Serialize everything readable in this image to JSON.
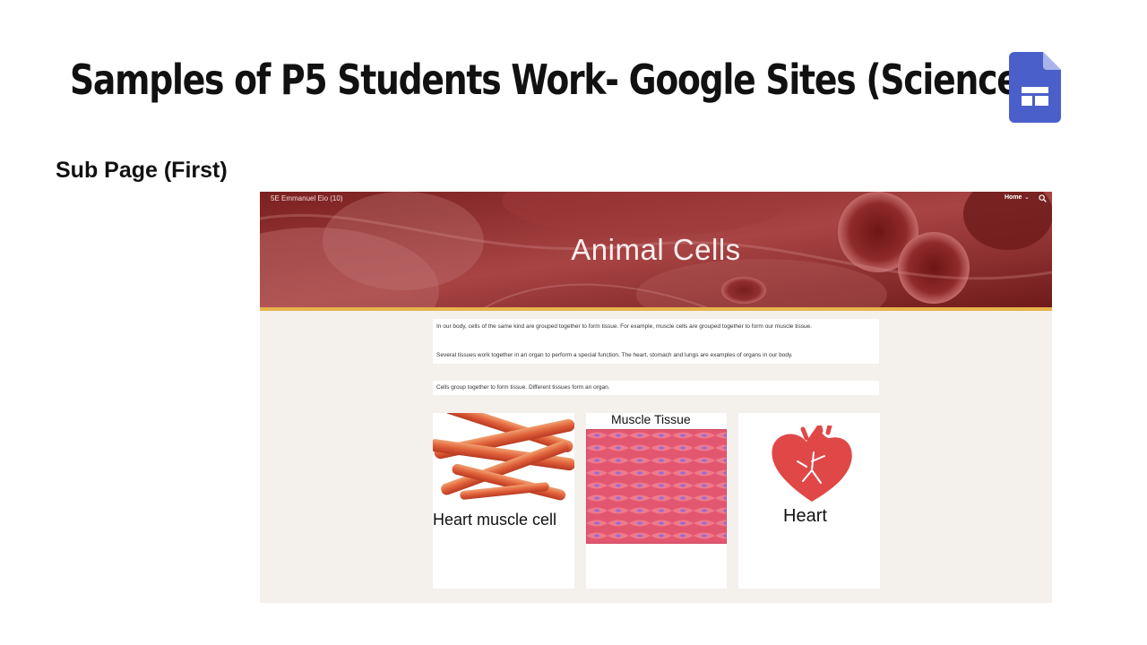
{
  "slide": {
    "title": "Samples of P5 Students Work- Google Sites (Science)",
    "subtitle": "Sub Page (First)"
  },
  "site": {
    "name": "5E Emmanuel Eio (10)",
    "nav": {
      "home_label": "Home"
    },
    "banner_title": "Animal Cells",
    "paragraph1": "In our body, cells of the same kind are grouped together to form tissue. For example, muscle cells are grouped together to form our muscle tissue.",
    "paragraph2": "Several tissues work together in an organ to perform a special function. The heart, stomach and lungs are examples of organs in our body.",
    "paragraph3": "Cells group together to form tissue. Different tissues form an organ.",
    "cards": [
      {
        "caption": "Heart muscle cell"
      },
      {
        "caption": "Muscle Tissue"
      },
      {
        "caption": "Heart"
      }
    ]
  },
  "colors": {
    "banner": "#8e2a2a",
    "accent_line": "#e7b34a",
    "page_bg": "#f4f0ec",
    "sites_logo": "#4a5fc9"
  },
  "icons": [
    "google-sites-icon",
    "search-icon",
    "chevron-down-icon"
  ]
}
